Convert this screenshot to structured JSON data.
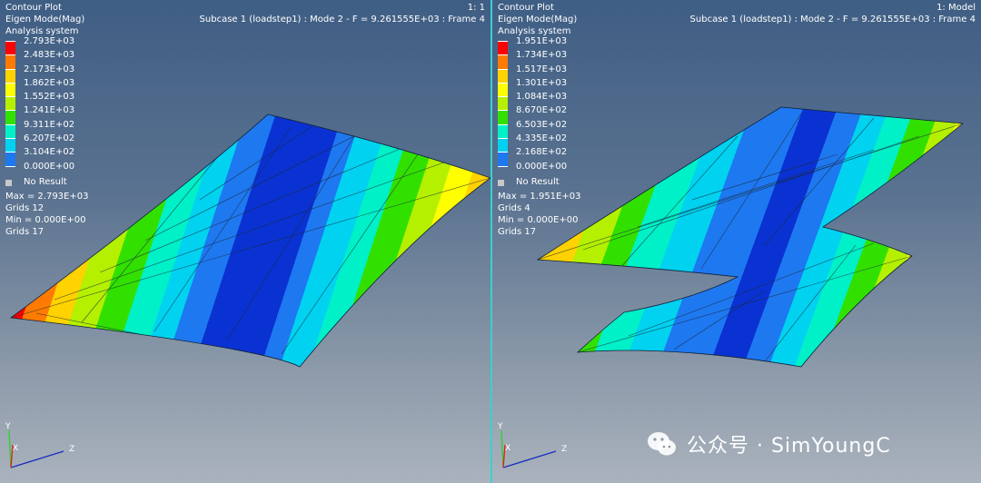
{
  "viewports": [
    {
      "header": [
        "Contour Plot",
        "Eigen Mode(Mag)",
        "Analysis system"
      ],
      "top_right": [
        "1: 1",
        "Subcase 1 (loadstep1) : Mode 2 - F = 9.261555E+03 : Frame 4"
      ],
      "legend": [
        "2.793E+03",
        "2.483E+03",
        "2.173E+03",
        "1.862E+03",
        "1.552E+03",
        "1.241E+03",
        "9.311E+02",
        "6.207E+02",
        "3.104E+02",
        "0.000E+00"
      ],
      "no_result": "No Result",
      "stats": [
        "Max = 2.793E+03",
        "Grids 12",
        "Min = 0.000E+00",
        "Grids 17"
      ],
      "axes": {
        "y": "Y",
        "x": "X",
        "z": "Z"
      }
    },
    {
      "header": [
        "Contour Plot",
        "Eigen Mode(Mag)",
        "Analysis system"
      ],
      "top_right": [
        "1: Model",
        "Subcase 1 (loadstep1) : Mode 2 - F = 9.261555E+03 : Frame 4"
      ],
      "legend": [
        "1.951E+03",
        "1.734E+03",
        "1.517E+03",
        "1.301E+03",
        "1.084E+03",
        "8.670E+02",
        "6.503E+02",
        "4.335E+02",
        "2.168E+02",
        "0.000E+00"
      ],
      "no_result": "No Result",
      "stats": [
        "Max = 1.951E+03",
        "Grids 4",
        "Min = 0.000E+00",
        "Grids 17"
      ],
      "axes": {
        "y": "Y",
        "x": "X",
        "z": "Z"
      }
    }
  ],
  "legend_colors": [
    "#ff0000",
    "#ff7a00",
    "#ffd200",
    "#ffff00",
    "#b4f000",
    "#32e000",
    "#00f0c8",
    "#00d2f0",
    "#1e78f0",
    "#0000c8"
  ],
  "watermark": {
    "icon": "wechat-icon",
    "text": "公众号 · SimYoungC"
  }
}
